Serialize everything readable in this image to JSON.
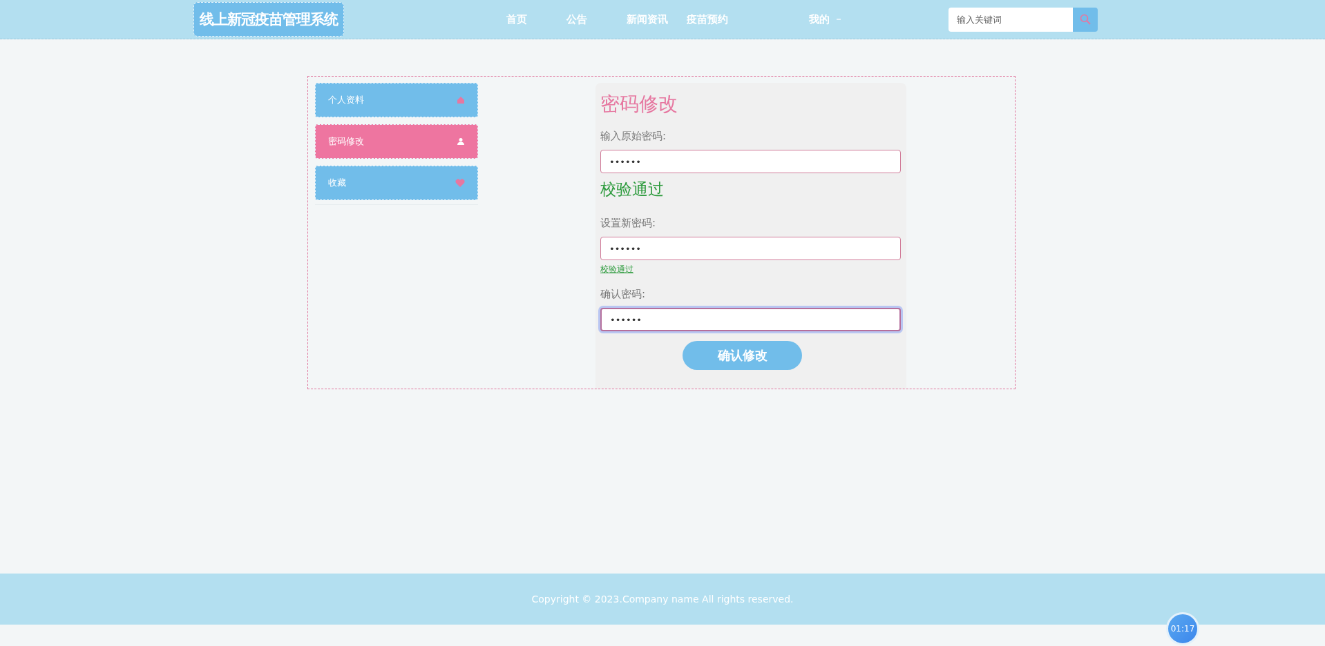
{
  "header": {
    "logo": "线上新冠疫苗管理系统",
    "nav": [
      {
        "label": "首页",
        "dropdown": false
      },
      {
        "label": "公告",
        "dropdown": false
      },
      {
        "label": "新闻资讯",
        "dropdown": false
      },
      {
        "label": "疫苗预约",
        "dropdown": false
      },
      {
        "label": "我的",
        "dropdown": true
      }
    ],
    "search": {
      "placeholder": "输入关键词"
    }
  },
  "sidebar": {
    "items": [
      {
        "label": "个人资料",
        "kind": "home",
        "selected": false
      },
      {
        "label": "密码修改",
        "kind": "user",
        "selected": true
      },
      {
        "label": "收藏",
        "kind": "heart",
        "selected": false
      }
    ]
  },
  "form": {
    "title": "密码修改",
    "fields": [
      {
        "label": "输入原始密码:",
        "value": "••••••",
        "focused": false,
        "message": {
          "text": "校验通过",
          "kind": "large"
        }
      },
      {
        "label": "设置新密码:",
        "value": "••••••",
        "focused": false,
        "message": {
          "text": "校验通过",
          "kind": "small"
        }
      },
      {
        "label": "确认密码:",
        "value": "••••••",
        "focused": true
      }
    ],
    "submit": "确认修改"
  },
  "footer": {
    "copyright": "Copyright © 2023.Company name All rights reserved."
  },
  "timer": "01:17"
}
